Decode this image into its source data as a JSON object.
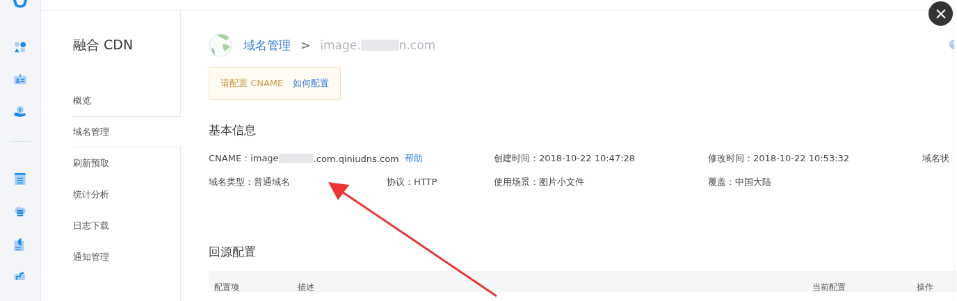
{
  "sidebar": {
    "title": "融合 CDN",
    "items": [
      {
        "label": "概览",
        "selected": false
      },
      {
        "label": "域名管理",
        "selected": true
      },
      {
        "label": "刷新预取",
        "selected": false
      },
      {
        "label": "统计分析",
        "selected": false
      },
      {
        "label": "日志下载",
        "selected": false
      },
      {
        "label": "通知管理",
        "selected": false
      }
    ]
  },
  "breadcrumb": {
    "parent": "域名管理",
    "separator": ">",
    "current_prefix": "image.",
    "current_suffix": "n.com"
  },
  "alert": {
    "message": "请配置 CNAME",
    "link": "如何配置"
  },
  "basic_info": {
    "title": "基本信息",
    "cname": {
      "label": "CNAME：",
      "prefix": "image",
      "suffix": ".com.qiniudns.com",
      "link": "帮助"
    },
    "first_line": [
      "创建时间：2018-10-22 10:47:28",
      "修改时间：2018-10-22 10:53:32",
      "域名状"
    ],
    "second_line": [
      "域名类型：普通域名",
      "协议：HTTP",
      "使用场景：图片小文件",
      "覆盖：中国大陆"
    ]
  },
  "origin_config": {
    "title": "回源配置",
    "table": {
      "columns": [
        "配置项",
        "描述",
        "当前配置",
        "操作"
      ]
    }
  }
}
